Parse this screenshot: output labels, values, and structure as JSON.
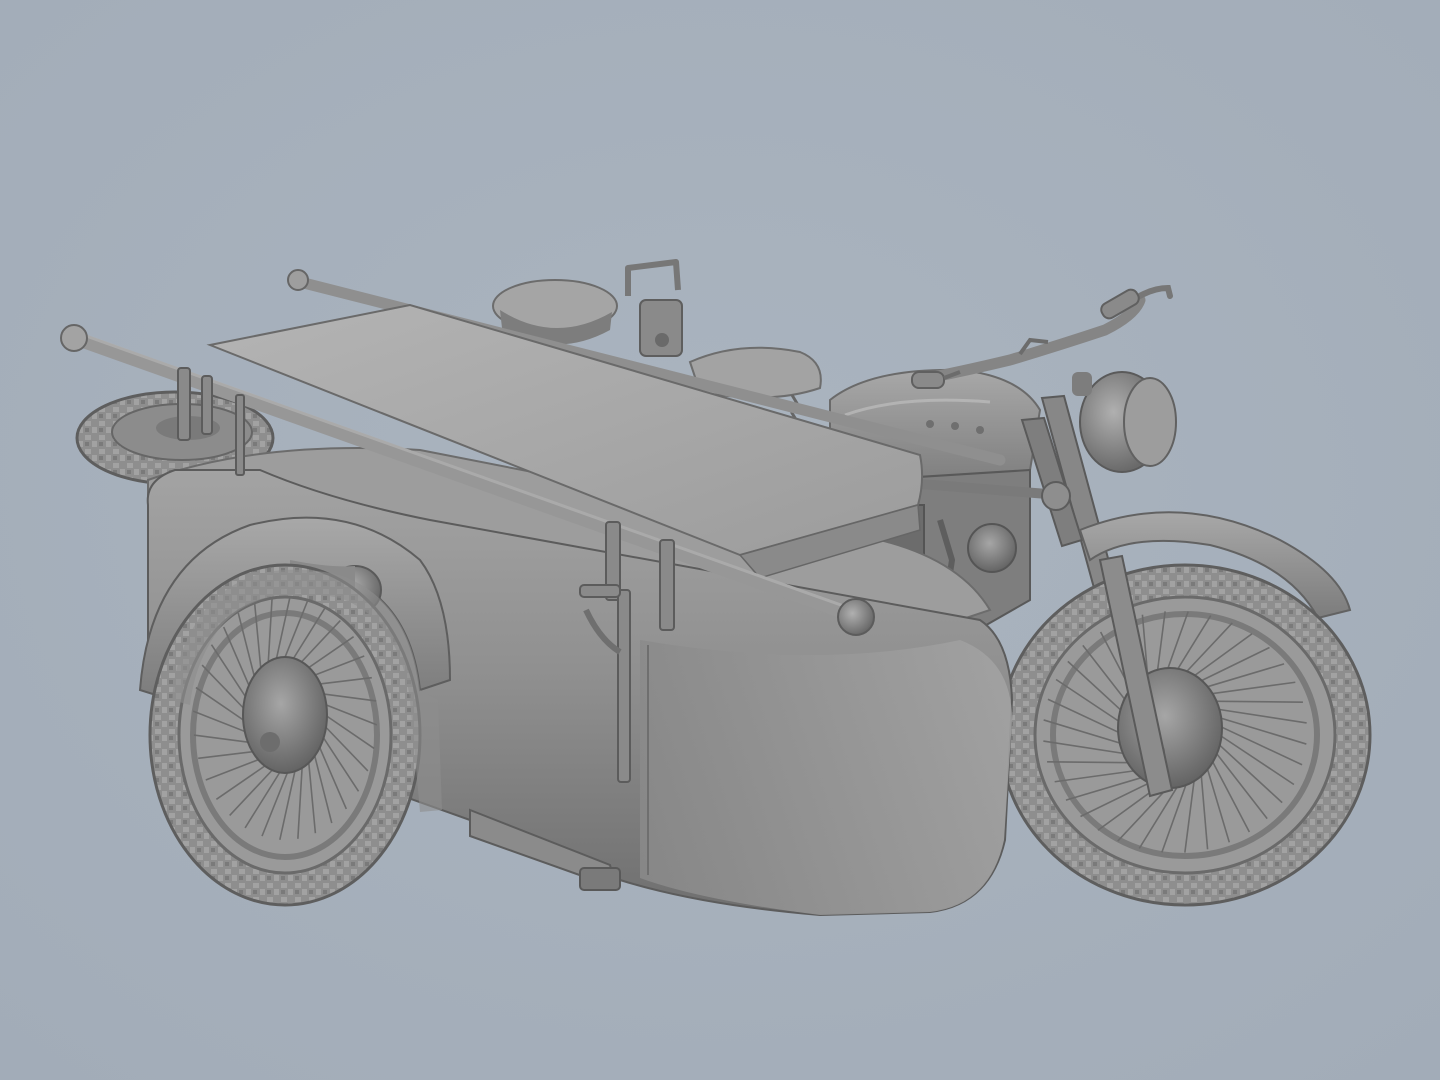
{
  "scene": {
    "subject": "motorcycle-with-sidecar-and-stretcher",
    "render_style": "untextured-grey-clay-3d-render"
  },
  "colors": {
    "background": "#aab4bf",
    "background_shade": "#a2acb8",
    "clay_light": "#a9a9a9",
    "clay_mid": "#8f8f8f",
    "clay_dark": "#6e6e6e",
    "clay_shadow": "#565656",
    "clay_highlight": "#bcbcbc"
  }
}
